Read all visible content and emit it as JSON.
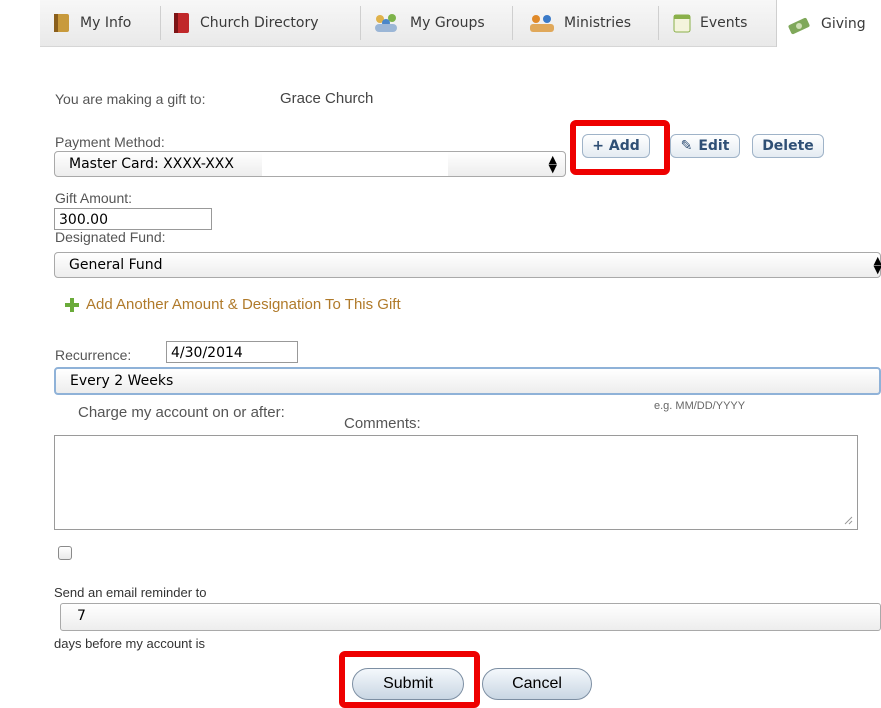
{
  "nav": {
    "tabs": [
      {
        "label": "My Info"
      },
      {
        "label": "Church Directory"
      },
      {
        "label": "My Groups"
      },
      {
        "label": "Ministries"
      },
      {
        "label": "Events"
      },
      {
        "label": "Giving"
      }
    ],
    "active": "Giving"
  },
  "gift": {
    "intro_label": "You are making a gift to:",
    "recipient": "Grace Church"
  },
  "payment": {
    "label": "Payment Method:",
    "selected": "Master Card: XXXX-XXX",
    "add_label": "+ Add",
    "edit_label": "Edit",
    "delete_label": "Delete"
  },
  "amount": {
    "label": "Gift Amount:",
    "value": "300.00"
  },
  "fund": {
    "label": "Designated Fund:",
    "selected": "General Fund"
  },
  "add_another": {
    "label": "Add Another Amount & Designation To This Gift"
  },
  "recurrence": {
    "label": "Recurrence:",
    "date_value": "4/30/2014",
    "selected": "Every 2 Weeks",
    "charge_label": "Charge my account on or after:",
    "date_hint": "e.g. MM/DD/YYYY"
  },
  "comments": {
    "label": "Comments:"
  },
  "reminder": {
    "label": "Send an email reminder to",
    "days_value": "7",
    "days_label": "days before my account is"
  },
  "actions": {
    "submit_label": "Submit",
    "cancel_label": "Cancel"
  },
  "colors": {
    "highlight": "#ee0000",
    "link": "#b07a2a",
    "pill_text": "#2f4f75"
  }
}
